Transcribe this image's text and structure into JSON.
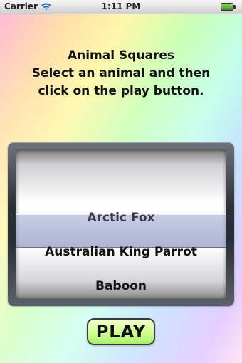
{
  "status_bar": {
    "carrier": "Carrier",
    "time": "1:11 PM",
    "icons": [
      "wifi-icon",
      "battery-icon"
    ]
  },
  "instructions": {
    "line1": "Animal Squares",
    "line2": "Select an animal and then",
    "line3": "click on the play button."
  },
  "picker": {
    "items": [
      "Arctic Fox",
      "Australian King Parrot",
      "Baboon"
    ],
    "selected": "Arctic Fox"
  },
  "play_button": {
    "label": "PLAY"
  },
  "colors": {
    "play_button_fill": "#cfff8f",
    "background_style": "rainbow-pastel"
  }
}
